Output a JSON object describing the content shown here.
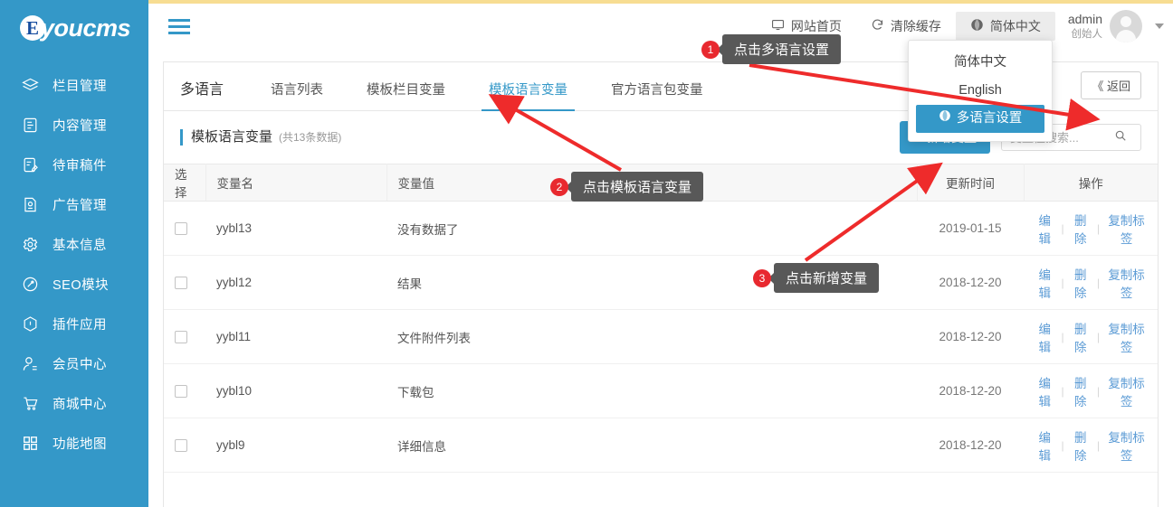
{
  "theme": {
    "brand": "#3498c8",
    "accent_red": "#e8292f",
    "link": "#5b9bd5",
    "top_strip": "#f7dd92",
    "callout_bg": "#585858"
  },
  "sidebar": {
    "logo_badge": "E",
    "logo_text": "youcms",
    "items": [
      {
        "icon": "layers-icon",
        "label": "栏目管理"
      },
      {
        "icon": "document-icon",
        "label": "内容管理"
      },
      {
        "icon": "review-icon",
        "label": "待审稿件"
      },
      {
        "icon": "ad-icon",
        "label": "广告管理"
      },
      {
        "icon": "gear-icon",
        "label": "基本信息"
      },
      {
        "icon": "seo-icon",
        "label": "SEO模块"
      },
      {
        "icon": "plugin-icon",
        "label": "插件应用"
      },
      {
        "icon": "member-icon",
        "label": "会员中心"
      },
      {
        "icon": "cart-icon",
        "label": "商城中心"
      },
      {
        "icon": "grid-icon",
        "label": "功能地图"
      }
    ]
  },
  "header": {
    "menu_toggle": "hamburger-icon",
    "site_home": "网站首页",
    "clear_cache": "清除缓存",
    "language": "简体中文",
    "user_name": "admin",
    "user_role": "创始人"
  },
  "language_dropdown": {
    "options": [
      "简体中文",
      "English"
    ],
    "settings_label": "多语言设置"
  },
  "content": {
    "section_title": "多语言",
    "tabs": [
      {
        "label": "语言列表",
        "active": false
      },
      {
        "label": "模板栏目变量",
        "active": false
      },
      {
        "label": "模板语言变量",
        "active": true
      },
      {
        "label": "官方语言包变量",
        "active": false
      }
    ],
    "return_button": "《 返回"
  },
  "toolbar": {
    "panel_title": "模板语言变量",
    "count_text": "(共13条数据)",
    "add_button": "＋新增变量",
    "search_placeholder": "变量值搜索...",
    "search_value": "",
    "search_icon": "search-icon"
  },
  "table": {
    "columns": [
      "选择",
      "变量名",
      "变量值",
      "更新时间",
      "操作"
    ],
    "ops": {
      "edit": "编辑",
      "delete": "删除",
      "copy_tag": "复制标签"
    },
    "rows": [
      {
        "name": "yybl13",
        "value": "没有数据了",
        "time": "2019-01-15"
      },
      {
        "name": "yybl12",
        "value": "结果",
        "time": "2018-12-20"
      },
      {
        "name": "yybl11",
        "value": "文件附件列表",
        "time": "2018-12-20"
      },
      {
        "name": "yybl10",
        "value": "下载包",
        "time": "2018-12-20"
      },
      {
        "name": "yybl9",
        "value": "详细信息",
        "time": "2018-12-20"
      }
    ]
  },
  "annotations": [
    {
      "num": "1",
      "text": "点击多语言设置"
    },
    {
      "num": "2",
      "text": "点击模板语言变量"
    },
    {
      "num": "3",
      "text": "点击新增变量"
    }
  ]
}
